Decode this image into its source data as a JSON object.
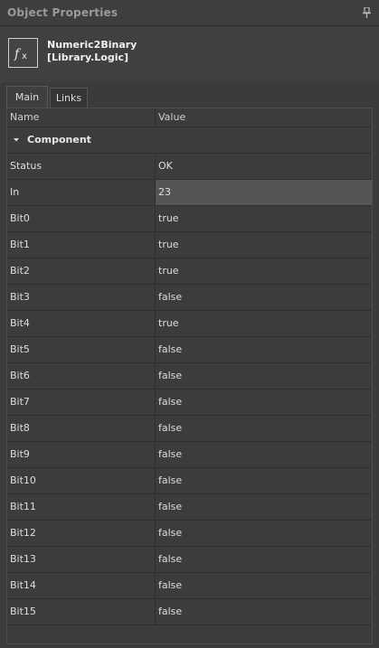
{
  "panel": {
    "title": "Object Properties",
    "pin_icon": "pin-icon"
  },
  "object": {
    "icon": "function-fx-icon",
    "name": "Numeric2Binary",
    "library": "[Library.Logic]"
  },
  "tabs": [
    {
      "label": "Main",
      "active": true
    },
    {
      "label": "Links",
      "active": false
    }
  ],
  "grid": {
    "columns": {
      "name": "Name",
      "value": "Value"
    },
    "category": "Component",
    "rows": [
      {
        "name": "Status",
        "value": "OK"
      },
      {
        "name": "In",
        "value": "23"
      },
      {
        "name": "Bit0",
        "value": "true"
      },
      {
        "name": "Bit1",
        "value": "true"
      },
      {
        "name": "Bit2",
        "value": "true"
      },
      {
        "name": "Bit3",
        "value": "false"
      },
      {
        "name": "Bit4",
        "value": "true"
      },
      {
        "name": "Bit5",
        "value": "false"
      },
      {
        "name": "Bit6",
        "value": "false"
      },
      {
        "name": "Bit7",
        "value": "false"
      },
      {
        "name": "Bit8",
        "value": "false"
      },
      {
        "name": "Bit9",
        "value": "false"
      },
      {
        "name": "Bit10",
        "value": "false"
      },
      {
        "name": "Bit11",
        "value": "false"
      },
      {
        "name": "Bit12",
        "value": "false"
      },
      {
        "name": "Bit13",
        "value": "false"
      },
      {
        "name": "Bit14",
        "value": "false"
      },
      {
        "name": "Bit15",
        "value": "false"
      }
    ]
  }
}
